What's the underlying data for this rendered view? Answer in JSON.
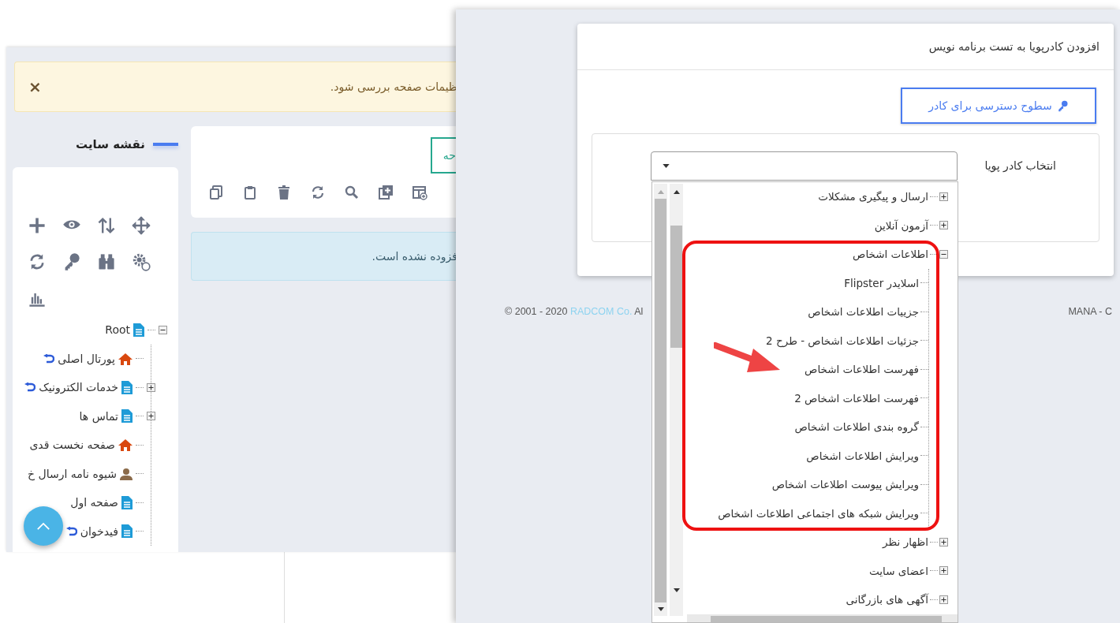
{
  "left_window": {
    "alert": {
      "text": "ظیمات صفحه بررسی شود.",
      "close": "×"
    },
    "sitemap": {
      "title": "نقشه سایت",
      "tree": {
        "label": "Root",
        "kind": "page",
        "expanded": true,
        "children": [
          {
            "label": "پورتال اصلی",
            "kind": "home",
            "linked": true
          },
          {
            "label": "خدمات الکترونیک",
            "kind": "page",
            "expanded": false,
            "linked": true
          },
          {
            "label": "تماس ها",
            "kind": "page",
            "expanded": false,
            "linked": false
          },
          {
            "label": "صفحه نخست قدی",
            "kind": "home",
            "linked": false
          },
          {
            "label": "شیوه نامه ارسال خ",
            "kind": "user",
            "linked": false
          },
          {
            "label": "صفحه اول",
            "kind": "page",
            "linked": false
          },
          {
            "label": "فیدخوان",
            "kind": "page",
            "linked": true
          }
        ]
      }
    },
    "page_card": {
      "button": "حه"
    },
    "info": {
      "text": "فزوده نشده است."
    }
  },
  "dialog": {
    "title": "افزودن کادرپویا به تست برنامه نویس",
    "access_button": "سطوح دسترسی برای کادر",
    "field_label": "انتخاب کادر پویا",
    "dropdown": {
      "expanded": true,
      "items": [
        {
          "label": "ارسال و پیگیری مشکلات",
          "expanded": false
        },
        {
          "label": "آزمون آنلاین",
          "expanded": false
        },
        {
          "label": "اطلاعات اشخاص",
          "expanded": true,
          "children": [
            {
              "label": "اسلایدر Flipster"
            },
            {
              "label": "جزیيات اطلاعات اشخاص"
            },
            {
              "label": "جزئیات اطلاعات اشخاص - طرح 2"
            },
            {
              "label": "فهرست اطلاعات اشخاص"
            },
            {
              "label": "فهرست اطلاعات اشخاص 2"
            },
            {
              "label": "گروه بندی اطلاعات اشخاص"
            },
            {
              "label": "ویرایش اطلاعات اشخاص"
            },
            {
              "label": "ویرایش پیوست اطلاعات اشخاص"
            },
            {
              "label": "ویرایش شبکه های اجتماعی اطلاعات اشخاص"
            }
          ]
        },
        {
          "label": "اظهار نظر",
          "expanded": false
        },
        {
          "label": "اعضای سایت",
          "expanded": false
        },
        {
          "label": "آگهی های بازرگانی",
          "expanded": false
        }
      ]
    }
  },
  "footer": {
    "copyright": "© 2001 - 2020",
    "company": "RADCOM Co.",
    "rest": "Al",
    "brand": "MANA - C"
  }
}
